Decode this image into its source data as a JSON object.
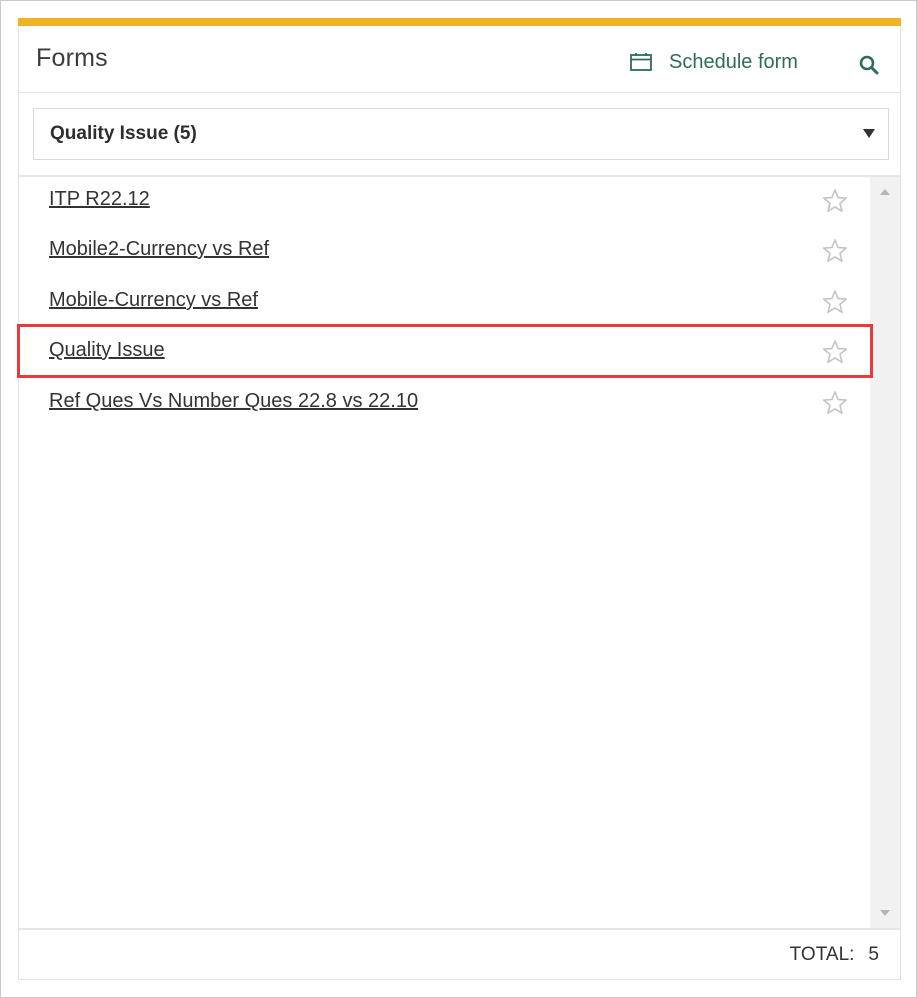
{
  "header": {
    "title": "Forms",
    "schedule_label": "Schedule form",
    "schedule_icon": "calendar-icon",
    "search_icon": "search-icon",
    "accent_color": "#f0b323",
    "action_color": "#2f6b5a"
  },
  "filter": {
    "selected": "Quality Issue (5)"
  },
  "forms": [
    {
      "label": "ITP R22.12"
    },
    {
      "label": "Mobile2-Currency vs Ref"
    },
    {
      "label": "Mobile-Currency vs Ref"
    },
    {
      "label": "Quality Issue",
      "highlighted": true
    },
    {
      "label": "Ref Ques Vs Number Ques 22.8 vs 22.10"
    }
  ],
  "footer": {
    "total_label": "TOTAL:",
    "total_value": "5"
  },
  "highlight_color": "#e8393b"
}
